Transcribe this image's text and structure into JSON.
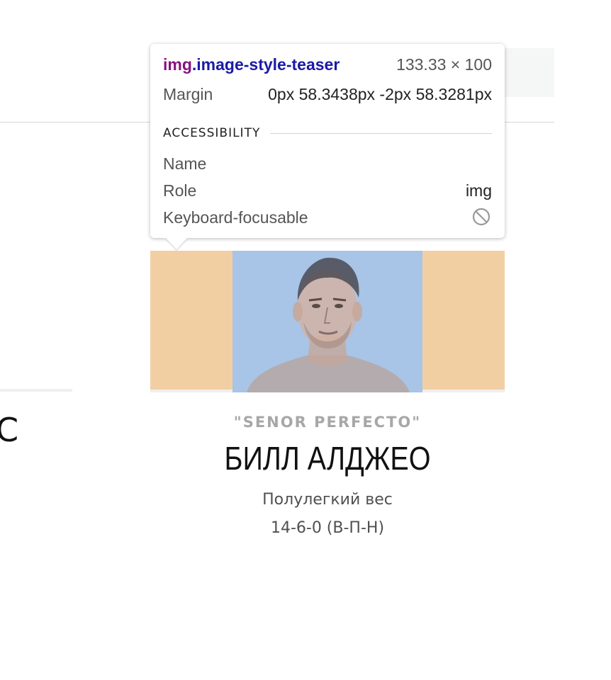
{
  "tooltip": {
    "selector_tag": "img",
    "selector_class": ".image-style-teaser",
    "dimensions": "133.33 × 100",
    "margin_label": "Margin",
    "margin_value": "0px 58.3438px -2px 58.3281px",
    "accessibility_heading": "ACCESSIBILITY",
    "name_label": "Name",
    "role_label": "Role",
    "role_value": "img",
    "keyboard_label": "Keyboard-focusable",
    "keyboard_icon": "not-allowed-icon"
  },
  "left_card": {
    "partial_text": "С"
  },
  "athlete": {
    "nickname": "\"SENOR PERFECTO\"",
    "name": "БИЛЛ АЛДЖЕО",
    "weight_class": "Полулегкий вес",
    "record": "14-6-0 (В-П-Н)"
  },
  "colors": {
    "margin_highlight": "#f2cfa3",
    "content_highlight": "#a8c4e6",
    "selector_tag": "#881280",
    "selector_class": "#1a1aa6"
  }
}
